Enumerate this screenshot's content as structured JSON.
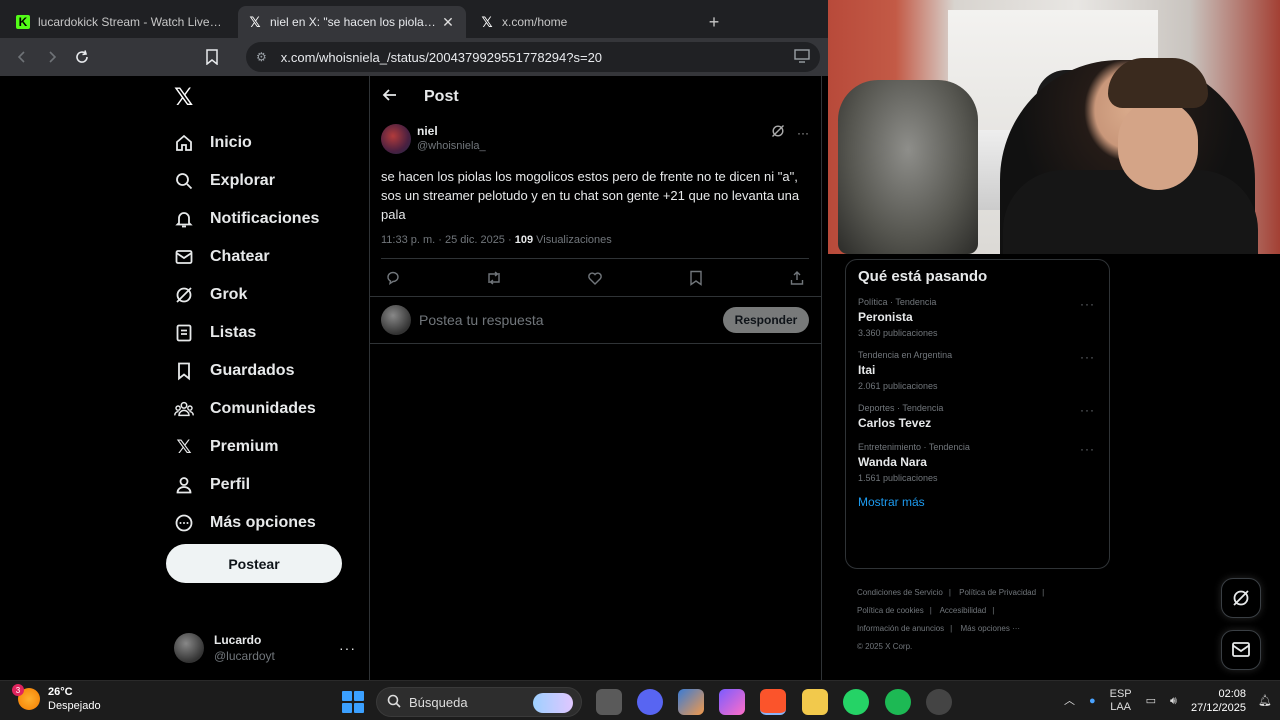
{
  "browser": {
    "tabs": [
      {
        "title": "lucardokick Stream - Watch Live on K",
        "icon": "kick-icon",
        "active": false
      },
      {
        "title": "niel en X: \"se hacen los piolas los",
        "icon": "x-icon",
        "active": true,
        "close": "✕"
      },
      {
        "title": "x.com/home",
        "icon": "x-icon",
        "active": false
      }
    ],
    "new_tab": "+",
    "url": "x.com/whoisniela_/status/2004379929551778294?s=20"
  },
  "sidebar": {
    "logo": "𝕏",
    "items": [
      {
        "label": "Inicio",
        "icon": "home-icon"
      },
      {
        "label": "Explorar",
        "icon": "search-icon"
      },
      {
        "label": "Notificaciones",
        "icon": "bell-icon"
      },
      {
        "label": "Chatear",
        "icon": "mail-icon"
      },
      {
        "label": "Grok",
        "icon": "grok-icon"
      },
      {
        "label": "Listas",
        "icon": "list-icon"
      },
      {
        "label": "Guardados",
        "icon": "bookmark-icon"
      },
      {
        "label": "Comunidades",
        "icon": "communities-icon"
      },
      {
        "label": "Premium",
        "icon": "x-icon"
      },
      {
        "label": "Perfil",
        "icon": "person-icon"
      },
      {
        "label": "Más opciones",
        "icon": "more-circle-icon"
      }
    ],
    "post_button": "Postear",
    "account": {
      "name": "Lucardo",
      "handle": "@lucardoyt",
      "more": "···"
    }
  },
  "main": {
    "title": "Post",
    "tweet": {
      "name": "niel",
      "handle": "@whoisniela_",
      "text": "se hacen los piolas los mogolicos estos pero de frente no te dicen ni \"a\", sos un streamer pelotudo y en tu chat son gente +21 que no levanta una pala",
      "time": "11:33 p. m. · 25 dic. 2025 · ",
      "views_count": "109",
      "views_label": " Visualizaciones"
    },
    "reply": {
      "placeholder": "Postea tu respuesta",
      "button": "Responder"
    }
  },
  "trends": {
    "title": "Qué está pasando",
    "items": [
      {
        "context": "Política · Tendencia",
        "name": "Peronista",
        "count": "3.360 publicaciones"
      },
      {
        "context": "Tendencia en Argentina",
        "name": "Itai",
        "count": "2.061 publicaciones"
      },
      {
        "context": "Deportes · Tendencia",
        "name": "Carlos Tevez",
        "count": ""
      },
      {
        "context": "Entretenimiento · Tendencia",
        "name": "Wanda Nara",
        "count": "1.561 publicaciones"
      }
    ],
    "more_dots": "···",
    "show_more": "Mostrar más"
  },
  "footer": {
    "links": [
      "Condiciones de Servicio",
      "Política de Privacidad",
      "Política de cookies",
      "Accesibilidad",
      "Información de anuncios",
      "Más opciones ···"
    ],
    "copyright": "© 2025 X Corp."
  },
  "taskbar": {
    "weather_temp": "26°C",
    "weather_desc": "Despejado",
    "weather_badge": "3",
    "search": "Búsqueda",
    "lang_1": "ESP",
    "lang_2": "LAA",
    "time": "02:08",
    "date": "27/12/2025"
  }
}
